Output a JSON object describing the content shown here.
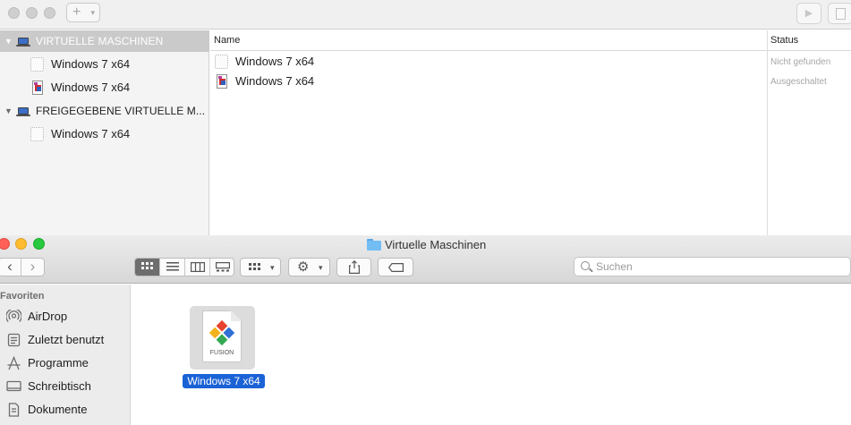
{
  "fusion": {
    "toolbar": {
      "add_label": "+",
      "add_chevron": "▾",
      "play_icon": "▶"
    },
    "sidebar": {
      "groups": [
        {
          "label": "VIRTUELLE MASCHINEN",
          "selected": true
        },
        {
          "label": "FREIGEGEBENE VIRTUELLE M...",
          "selected": false
        }
      ],
      "vms": [
        {
          "label": "Windows 7 x64",
          "icon": "missing-vm-icon"
        },
        {
          "label": "Windows 7 x64",
          "icon": "windows-vm-icon"
        },
        {
          "label": "Windows 7 x64",
          "icon": "missing-vm-icon"
        }
      ]
    },
    "list": {
      "columns": [
        "Name",
        "Status"
      ],
      "rows": [
        {
          "name": "Windows 7 x64",
          "status": "Nicht gefunden",
          "icon": "missing-vm-icon"
        },
        {
          "name": "Windows 7 x64",
          "status": "Ausgeschaltet",
          "icon": "windows-vm-icon"
        }
      ]
    }
  },
  "finder": {
    "title": "Virtuelle Maschinen",
    "toolbar": {
      "back": "‹",
      "forward": "›"
    },
    "search": {
      "placeholder": "Suchen"
    },
    "sidebar": {
      "heading": "Favoriten",
      "items": [
        {
          "label": "AirDrop",
          "icon": "airdrop-icon"
        },
        {
          "label": "Zuletzt benutzt",
          "icon": "recents-icon"
        },
        {
          "label": "Programme",
          "icon": "applications-icon"
        },
        {
          "label": "Schreibtisch",
          "icon": "desktop-icon"
        },
        {
          "label": "Dokumente",
          "icon": "documents-icon"
        }
      ]
    },
    "files": [
      {
        "name": "Windows 7 x64",
        "badge": "FUSION",
        "selected": true
      }
    ]
  },
  "colors": {
    "selection_blue": "#1a62d6",
    "sidebar_selected": "#cacaca",
    "status_gray": "#a6a6a6"
  }
}
